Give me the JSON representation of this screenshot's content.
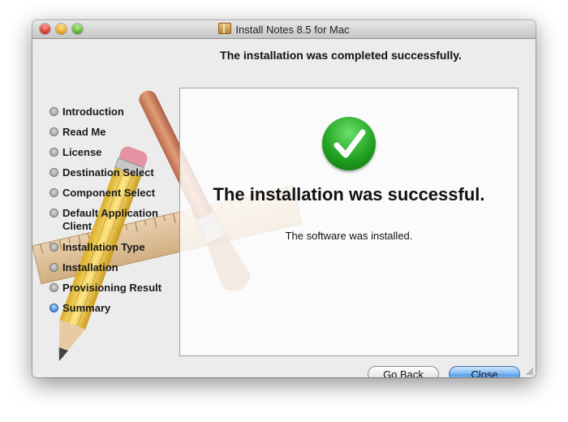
{
  "window": {
    "title": "Install Notes 8.5 for Mac"
  },
  "header": {
    "heading": "The installation was completed successfully."
  },
  "sidebar": {
    "steps": [
      {
        "label": "Introduction"
      },
      {
        "label": "Read Me"
      },
      {
        "label": "License"
      },
      {
        "label": "Destination Select"
      },
      {
        "label": "Component Select"
      },
      {
        "label": "Default Application Client"
      },
      {
        "label": "Installation Type"
      },
      {
        "label": "Installation"
      },
      {
        "label": "Provisioning Result"
      },
      {
        "label": "Summary"
      }
    ],
    "active_step": "Summary"
  },
  "main": {
    "success_title": "The installation was successful.",
    "success_message": "The software was installed."
  },
  "buttons": {
    "back_label": "Go Back",
    "close_label": "Close"
  },
  "colors": {
    "success_green": "#22a322",
    "default_button_blue": "#79b4f2",
    "active_step_bullet": "#3a83d8"
  }
}
